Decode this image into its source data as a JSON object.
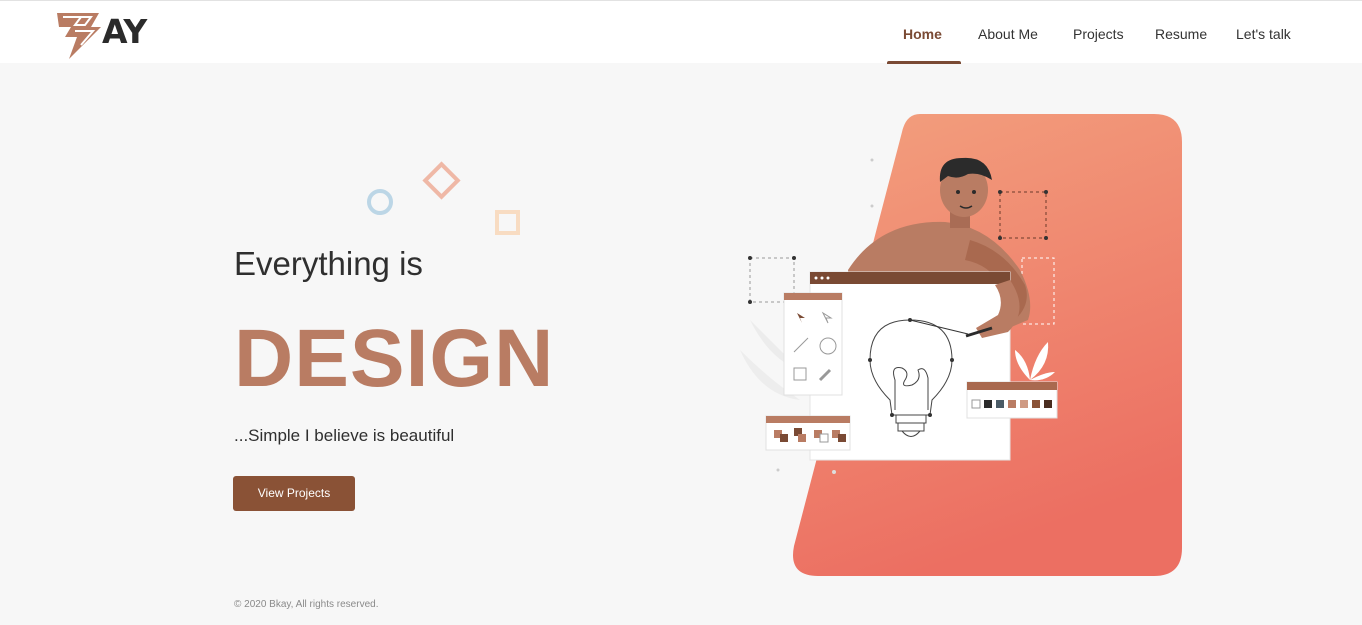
{
  "brand": {
    "logo_letter": "B",
    "logo_text": "AY"
  },
  "nav": {
    "items": [
      {
        "label": "Home",
        "active": true
      },
      {
        "label": "About Me",
        "active": false
      },
      {
        "label": "Projects",
        "active": false
      },
      {
        "label": "Resume",
        "active": false
      },
      {
        "label": "Let's talk",
        "active": false
      }
    ]
  },
  "hero": {
    "line1": "Everything is",
    "headline": "DESIGN",
    "tagline": "...Simple I believe is beautiful",
    "cta_label": "View Projects"
  },
  "footer": {
    "copyright": "© 2020 Bkay, All rights reserved."
  },
  "colors": {
    "accent": "#b97c63",
    "button": "#8a5236",
    "nav_active": "#7a4a34",
    "panel_gradient_top": "#f3a07e",
    "panel_gradient_bottom": "#ec6f62"
  },
  "icons": {
    "logo": "bolt-logo-icon",
    "illustration": "designer-drawing-lightbulb-illustration"
  }
}
